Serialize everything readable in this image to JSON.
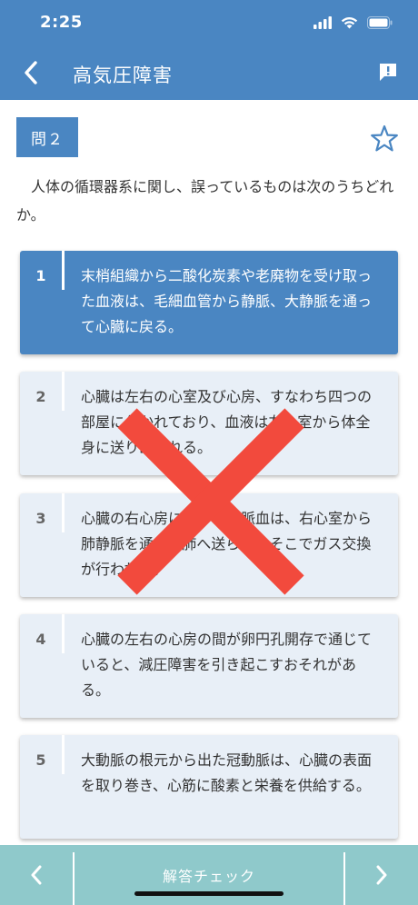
{
  "status": {
    "time": "2:25",
    "icons": [
      "signal-icon",
      "wifi-icon",
      "battery-icon"
    ]
  },
  "nav": {
    "title": "高気圧障害",
    "back_icon": "chevron-left-icon",
    "report_icon": "report-icon"
  },
  "question": {
    "label": "問２",
    "text": "人体の循環器系に関し、誤っているものは次のうちどれか。",
    "bookmark_icon": "star-outline-icon"
  },
  "choices": [
    {
      "num": "1",
      "text": "末梢組織から二酸化炭素や老廃物を受け取った血液は、毛細血管から静脈、大静脈を通って心臓に戻る。",
      "selected": true
    },
    {
      "num": "2",
      "text": "心臓は左右の心室及び心房、すなわち四つの部屋に分かれており、血液は左心室から体全身に送り出される。",
      "selected": false
    },
    {
      "num": "3",
      "text": "心臓の右心房に戻った静脈血は、右心室から肺静脈を通って肺へ送られ、そこでガス交換が行われる。",
      "selected": false
    },
    {
      "num": "4",
      "text": "心臓の左右の心房の間が卵円孔開存で通じていると、減圧障害を引き起こすおそれがある。",
      "selected": false
    },
    {
      "num": "5",
      "text": "大動脈の根元から出た冠動脈は、心臓の表面を取り巻き、心筋に酸素と栄養を供給する。",
      "selected": false
    }
  ],
  "result": {
    "mark": "incorrect-cross-icon",
    "color": "#f24a3d"
  },
  "bottom": {
    "check_label": "解答チェック",
    "prev_icon": "chevron-left-icon",
    "next_icon": "chevron-right-icon"
  },
  "colors": {
    "primary": "#4a86c2",
    "choice_bg": "#e8eff7",
    "bottom_bar": "#8fc9cb"
  }
}
